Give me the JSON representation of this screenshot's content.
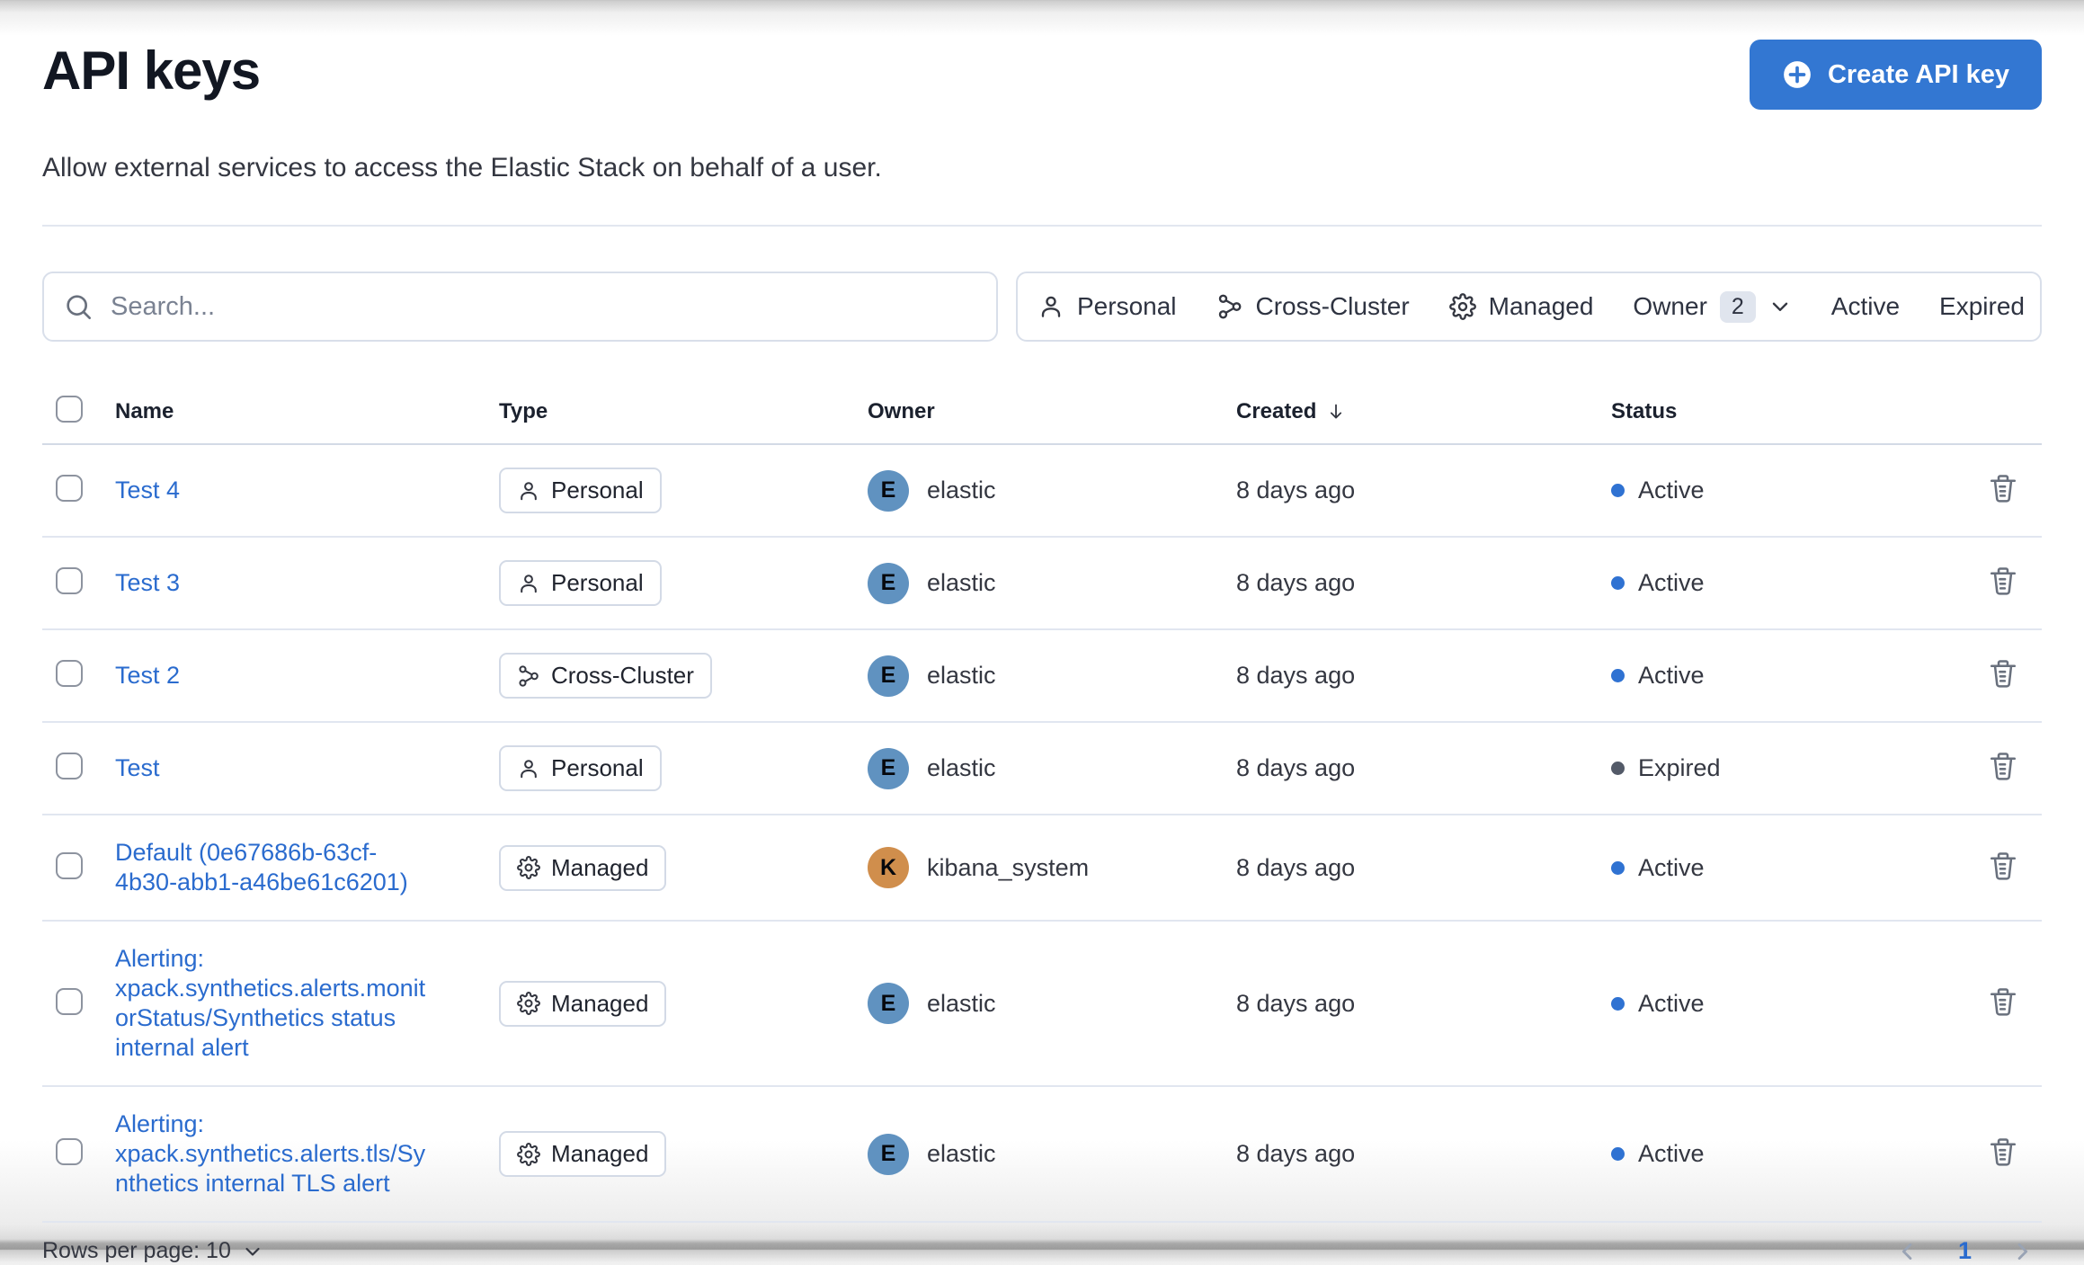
{
  "page": {
    "title": "API keys",
    "subtitle": "Allow external services to access the Elastic Stack on behalf of a user.",
    "create_button_label": "Create API key"
  },
  "toolbar": {
    "search_placeholder": "Search...",
    "filter_personal": "Personal",
    "filter_cross_cluster": "Cross-Cluster",
    "filter_managed": "Managed",
    "owner_label": "Owner",
    "owner_count": "2",
    "filter_active": "Active",
    "filter_expired": "Expired"
  },
  "table": {
    "headers": {
      "name": "Name",
      "type": "Type",
      "owner": "Owner",
      "created": "Created",
      "status": "Status"
    },
    "rows": [
      {
        "name": "Test 4",
        "type": "Personal",
        "owner": "elastic",
        "owner_initial": "E",
        "created": "8 days ago",
        "status": "Active"
      },
      {
        "name": "Test 3",
        "type": "Personal",
        "owner": "elastic",
        "owner_initial": "E",
        "created": "8 days ago",
        "status": "Active"
      },
      {
        "name": "Test 2",
        "type": "Cross-Cluster",
        "owner": "elastic",
        "owner_initial": "E",
        "created": "8 days ago",
        "status": "Active"
      },
      {
        "name": "Test",
        "type": "Personal",
        "owner": "elastic",
        "owner_initial": "E",
        "created": "8 days ago",
        "status": "Expired"
      },
      {
        "name": "Default (0e67686b-63cf-4b30-abb1-a46be61c6201)",
        "type": "Managed",
        "owner": "kibana_system",
        "owner_initial": "K",
        "created": "8 days ago",
        "status": "Active"
      },
      {
        "name": "Alerting: xpack.synthetics.alerts.monitorStatus/Synthetics status internal alert",
        "type": "Managed",
        "owner": "elastic",
        "owner_initial": "E",
        "created": "8 days ago",
        "status": "Active"
      },
      {
        "name": "Alerting: xpack.synthetics.alerts.tls/Synthetics internal TLS alert",
        "type": "Managed",
        "owner": "elastic",
        "owner_initial": "E",
        "created": "8 days ago",
        "status": "Active"
      }
    ]
  },
  "pagination": {
    "rows_per_page_label": "Rows per page: 10",
    "current_page": "1"
  },
  "colors": {
    "primary_button": "#3377d2",
    "link_blue": "#2a6bce",
    "active_dot": "#2f72d2",
    "expired_dot": "#535a68",
    "avatar_elastic": "#6092c0",
    "avatar_kibana_system": "#d08e4c",
    "border": "#d3dae6"
  }
}
